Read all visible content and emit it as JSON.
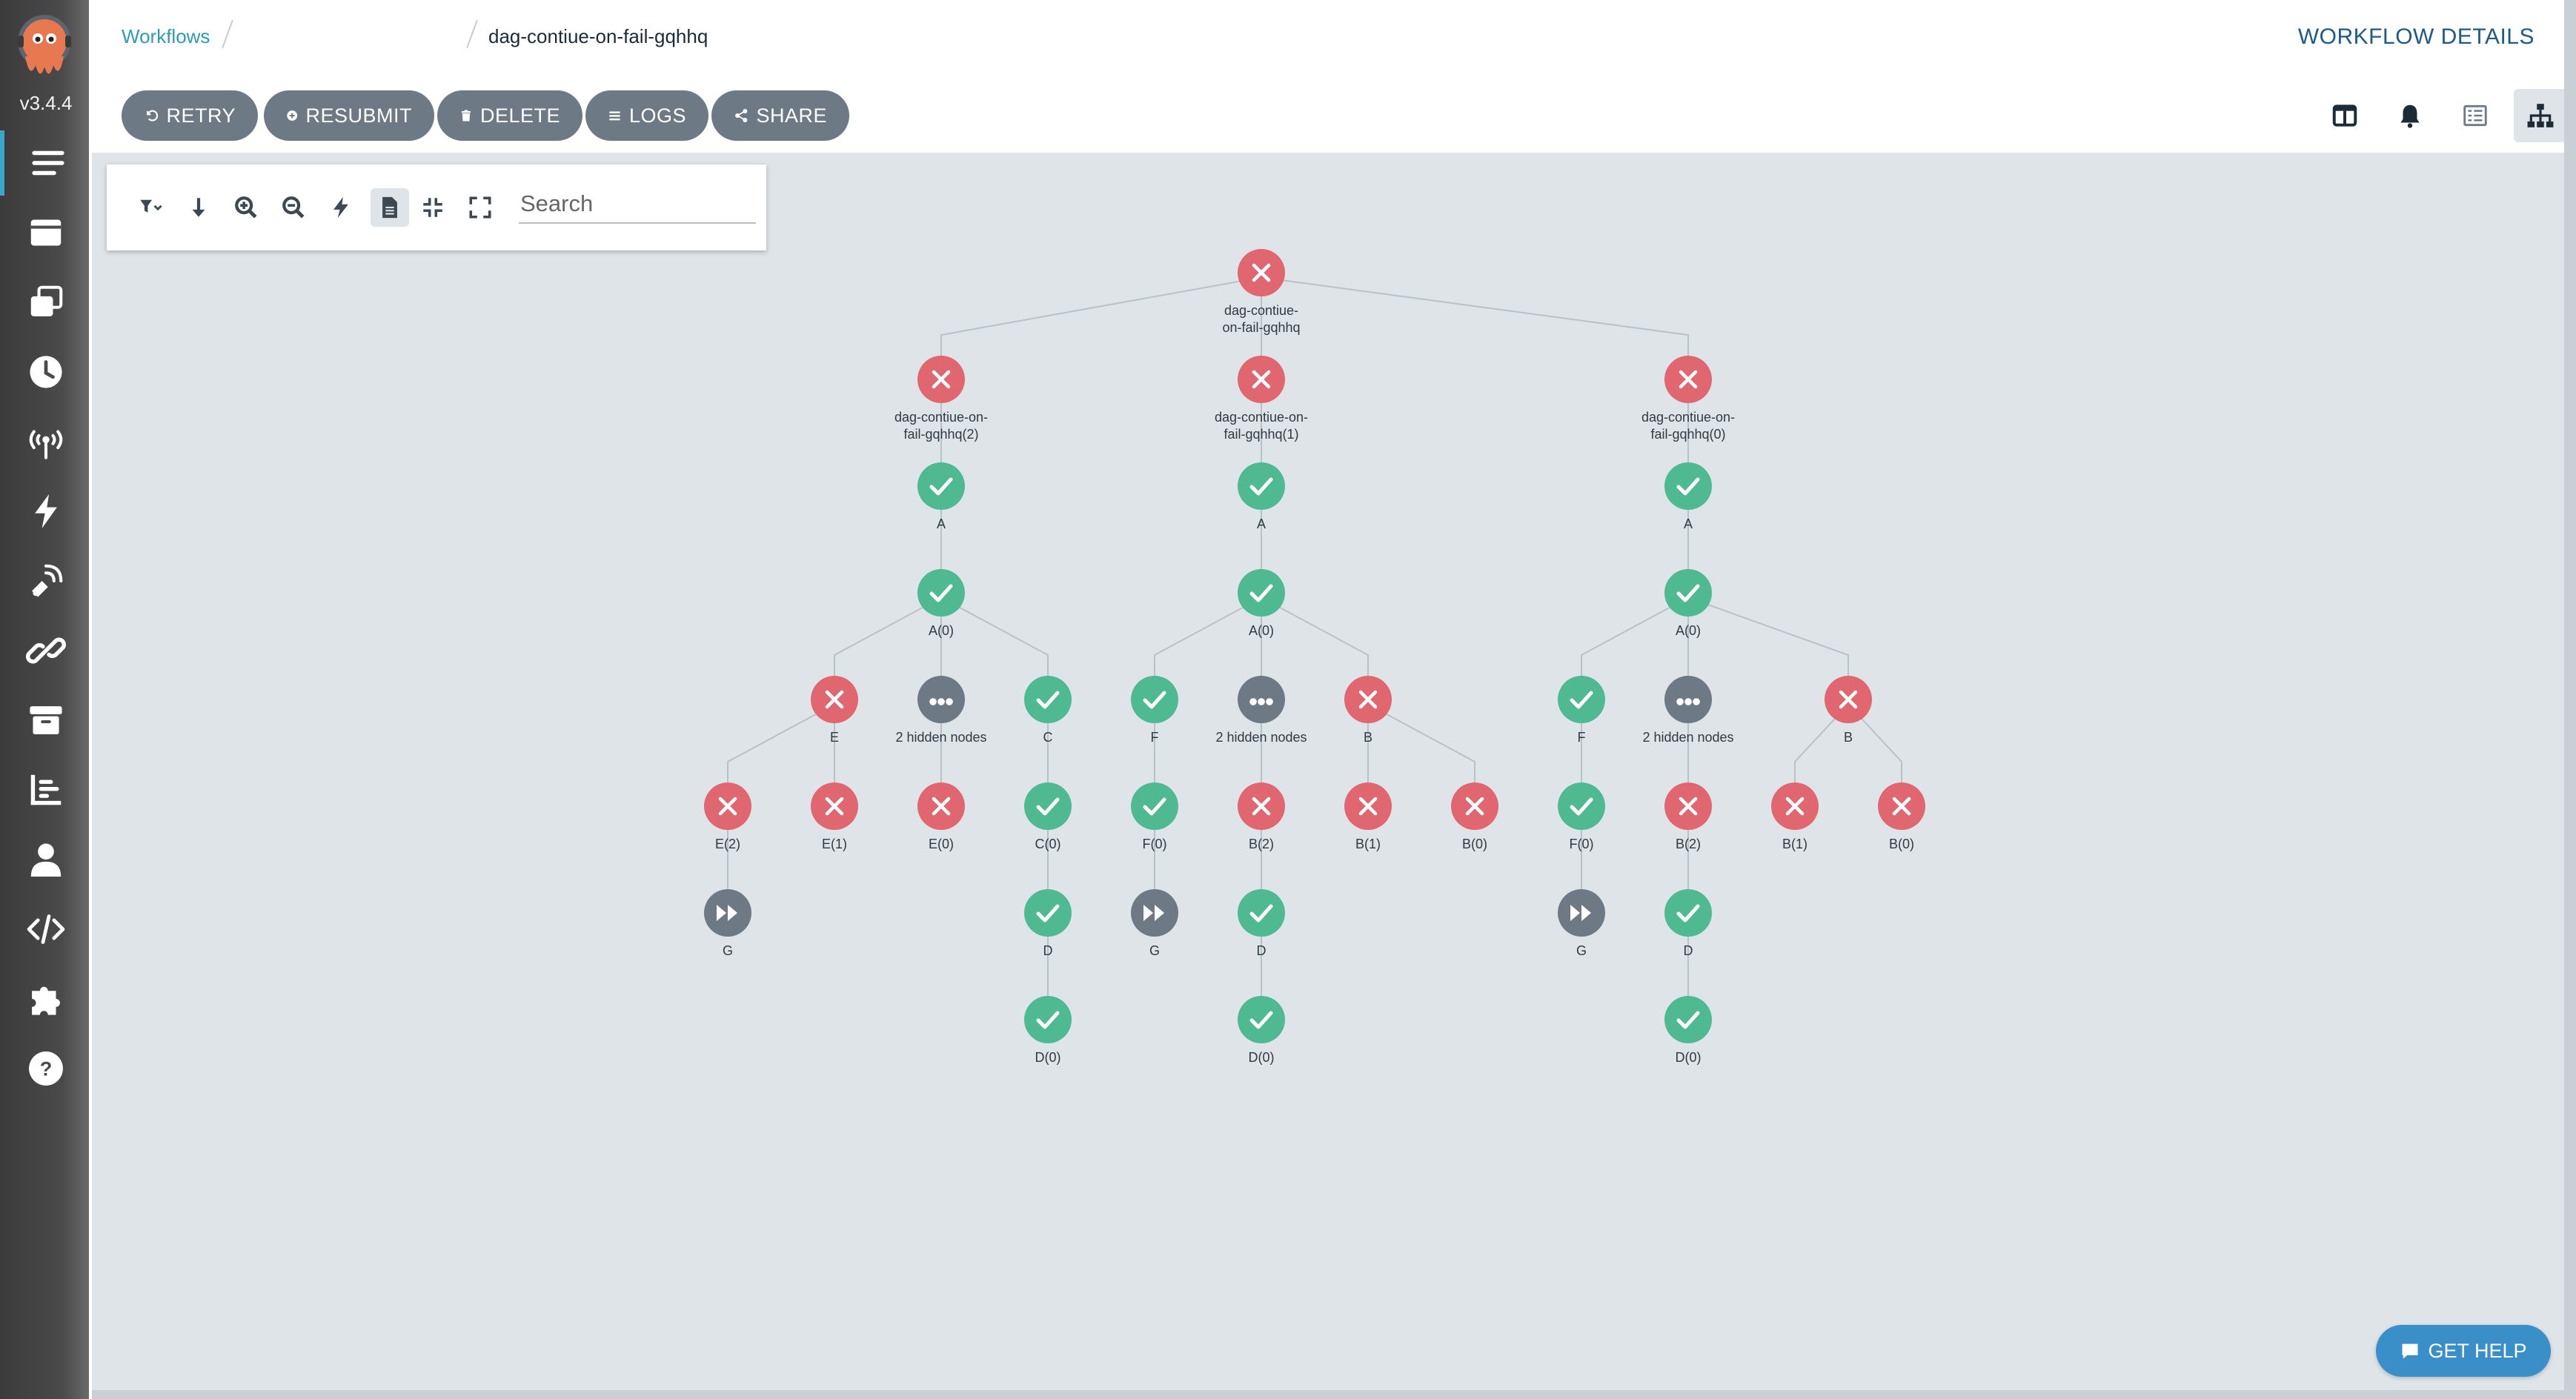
{
  "app": {
    "version": "v3.4.4",
    "logo_icon": "argo-octopus-icon"
  },
  "sidebar": {
    "items": [
      {
        "icon": "workflows-list-icon",
        "active": true
      },
      {
        "icon": "workflow-templates-icon"
      },
      {
        "icon": "cluster-workflow-templates-icon"
      },
      {
        "icon": "cron-workflows-icon"
      },
      {
        "icon": "event-sources-icon"
      },
      {
        "icon": "sensors-icon"
      },
      {
        "icon": "event-flow-icon"
      },
      {
        "icon": "link-icon"
      },
      {
        "icon": "archive-icon"
      },
      {
        "icon": "reports-icon"
      },
      {
        "icon": "user-icon"
      },
      {
        "icon": "api-docs-icon"
      },
      {
        "icon": "plugins-icon"
      },
      {
        "icon": "help-icon"
      }
    ]
  },
  "header": {
    "breadcrumb_root": "Workflows",
    "breadcrumb_current": "dag-contiue-on-fail-gqhhq",
    "title": "WORKFLOW DETAILS"
  },
  "toolbar": {
    "retry": "RETRY",
    "resubmit": "RESUBMIT",
    "delete": "DELETE",
    "logs": "LOGS",
    "share": "SHARE"
  },
  "view_buttons": [
    {
      "icon": "split-panel-icon"
    },
    {
      "icon": "bell-icon"
    },
    {
      "icon": "timeline-list-icon"
    },
    {
      "icon": "sitemap-icon",
      "selected": true
    }
  ],
  "graph_panel": {
    "tools": [
      "filter-icon",
      "arrow-down-icon",
      "zoom-in-icon",
      "zoom-out-icon",
      "lightning-icon",
      "file-icon",
      "compress-icon",
      "expand-icon"
    ],
    "search_placeholder": "Search"
  },
  "colors": {
    "failed": "#e0676f",
    "succeeded": "#4fb992",
    "skipped": "#6d7a86",
    "accent": "#2d9bb4",
    "edge": "#b8c2c9"
  },
  "graph": {
    "nodes": [
      {
        "id": "root",
        "status": "failed",
        "label": [
          "dag-contiue-",
          "on-fail-gqhhq"
        ]
      },
      {
        "id": "r2",
        "status": "failed",
        "label": [
          "dag-contiue-on-",
          "fail-gqhhq(2)"
        ]
      },
      {
        "id": "r1",
        "status": "failed",
        "label": [
          "dag-contiue-on-",
          "fail-gqhhq(1)"
        ]
      },
      {
        "id": "r0",
        "status": "failed",
        "label": [
          "dag-contiue-on-",
          "fail-gqhhq(0)"
        ]
      },
      {
        "id": "a2",
        "status": "succeeded",
        "label": [
          "A"
        ]
      },
      {
        "id": "a1",
        "status": "succeeded",
        "label": [
          "A"
        ]
      },
      {
        "id": "a0",
        "status": "succeeded",
        "label": [
          "A"
        ]
      },
      {
        "id": "a20",
        "status": "succeeded",
        "label": [
          "A(0)"
        ]
      },
      {
        "id": "a10",
        "status": "succeeded",
        "label": [
          "A(0)"
        ]
      },
      {
        "id": "a00",
        "status": "succeeded",
        "label": [
          "A(0)"
        ]
      },
      {
        "id": "e2",
        "status": "failed",
        "label": [
          "E"
        ]
      },
      {
        "id": "h2",
        "status": "hidden",
        "label": [
          "2 hidden nodes"
        ]
      },
      {
        "id": "c2",
        "status": "succeeded",
        "label": [
          "C"
        ]
      },
      {
        "id": "f1",
        "status": "succeeded",
        "label": [
          "F"
        ]
      },
      {
        "id": "h1",
        "status": "hidden",
        "label": [
          "2 hidden nodes"
        ]
      },
      {
        "id": "b1",
        "status": "failed",
        "label": [
          "B"
        ]
      },
      {
        "id": "f0",
        "status": "succeeded",
        "label": [
          "F"
        ]
      },
      {
        "id": "h0",
        "status": "hidden",
        "label": [
          "2 hidden nodes"
        ]
      },
      {
        "id": "b0",
        "status": "failed",
        "label": [
          "B"
        ]
      },
      {
        "id": "e22",
        "status": "failed",
        "label": [
          "E(2)"
        ]
      },
      {
        "id": "e21",
        "status": "failed",
        "label": [
          "E(1)"
        ]
      },
      {
        "id": "e20",
        "status": "failed",
        "label": [
          "E(0)"
        ]
      },
      {
        "id": "c20",
        "status": "succeeded",
        "label": [
          "C(0)"
        ]
      },
      {
        "id": "f10",
        "status": "succeeded",
        "label": [
          "F(0)"
        ]
      },
      {
        "id": "b12",
        "status": "failed",
        "label": [
          "B(2)"
        ]
      },
      {
        "id": "b11",
        "status": "failed",
        "label": [
          "B(1)"
        ]
      },
      {
        "id": "b10",
        "status": "failed",
        "label": [
          "B(0)"
        ]
      },
      {
        "id": "f00",
        "status": "succeeded",
        "label": [
          "F(0)"
        ]
      },
      {
        "id": "b02",
        "status": "failed",
        "label": [
          "B(2)"
        ]
      },
      {
        "id": "b01",
        "status": "failed",
        "label": [
          "B(1)"
        ]
      },
      {
        "id": "b00",
        "status": "failed",
        "label": [
          "B(0)"
        ]
      },
      {
        "id": "g2",
        "status": "skipped",
        "label": [
          "G"
        ]
      },
      {
        "id": "d2",
        "status": "succeeded",
        "label": [
          "D"
        ]
      },
      {
        "id": "g1",
        "status": "skipped",
        "label": [
          "G"
        ]
      },
      {
        "id": "d1",
        "status": "succeeded",
        "label": [
          "D"
        ]
      },
      {
        "id": "g0",
        "status": "skipped",
        "label": [
          "G"
        ]
      },
      {
        "id": "d0",
        "status": "succeeded",
        "label": [
          "D"
        ]
      },
      {
        "id": "d20",
        "status": "succeeded",
        "label": [
          "D(0)"
        ]
      },
      {
        "id": "d10",
        "status": "succeeded",
        "label": [
          "D(0)"
        ]
      },
      {
        "id": "d00",
        "status": "succeeded",
        "label": [
          "D(0)"
        ]
      }
    ],
    "edges": [
      [
        "root",
        "r2"
      ],
      [
        "root",
        "r1"
      ],
      [
        "root",
        "r0"
      ],
      [
        "r2",
        "a2"
      ],
      [
        "r1",
        "a1"
      ],
      [
        "r0",
        "a0"
      ],
      [
        "a2",
        "a20"
      ],
      [
        "a1",
        "a10"
      ],
      [
        "a0",
        "a00"
      ],
      [
        "a20",
        "e2"
      ],
      [
        "a20",
        "h2"
      ],
      [
        "a20",
        "c2"
      ],
      [
        "a10",
        "f1"
      ],
      [
        "a10",
        "h1"
      ],
      [
        "a10",
        "b1"
      ],
      [
        "a00",
        "f0"
      ],
      [
        "a00",
        "h0"
      ],
      [
        "a00",
        "b0"
      ],
      [
        "e2",
        "e22"
      ],
      [
        "e2",
        "e21"
      ],
      [
        "h2",
        "e20"
      ],
      [
        "c2",
        "c20"
      ],
      [
        "f1",
        "f10"
      ],
      [
        "h1",
        "b12"
      ],
      [
        "b1",
        "b11"
      ],
      [
        "b1",
        "b10"
      ],
      [
        "f0",
        "f00"
      ],
      [
        "h0",
        "b02"
      ],
      [
        "b0",
        "b01"
      ],
      [
        "b0",
        "b00"
      ],
      [
        "e22",
        "g2"
      ],
      [
        "c20",
        "d2"
      ],
      [
        "f10",
        "g1"
      ],
      [
        "b12",
        "d1"
      ],
      [
        "f00",
        "g0"
      ],
      [
        "b02",
        "d0"
      ],
      [
        "d2",
        "d20"
      ],
      [
        "d1",
        "d10"
      ],
      [
        "d0",
        "d00"
      ]
    ]
  },
  "help_button": "GET HELP"
}
